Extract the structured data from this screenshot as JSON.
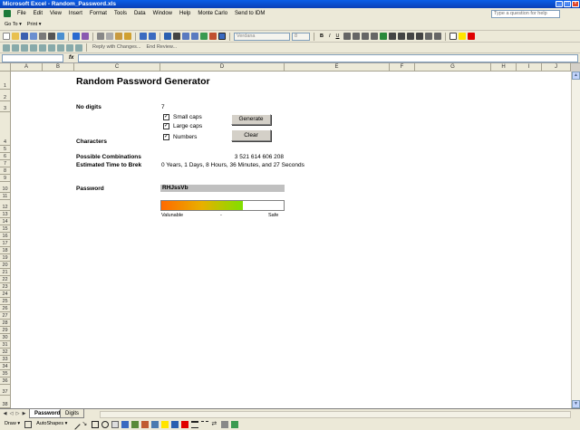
{
  "window": {
    "title": "Microsoft Excel - Random_Password.xls"
  },
  "menu": [
    "File",
    "Edit",
    "View",
    "Insert",
    "Format",
    "Tools",
    "Data",
    "Window",
    "Help",
    "Monte Carlo",
    "Send to IDM"
  ],
  "help_search": {
    "placeholder": "Type a question for help"
  },
  "toolbar": {
    "goto_label": "Go To",
    "print_label": "Print",
    "font_name": "Verdana",
    "font_size": "8",
    "reply_changes": "Reply with Changes...",
    "end_review": "End Review..."
  },
  "formula_bar": {
    "fx": "fx"
  },
  "columns": [
    "A",
    "B",
    "C",
    "D",
    "E",
    "F",
    "G",
    "H",
    "I",
    "J"
  ],
  "rows": [
    "1",
    "2",
    "3",
    "4",
    "5",
    "6",
    "7",
    "8",
    "9",
    "10",
    "11",
    "12",
    "13",
    "14",
    "15",
    "16",
    "17",
    "18",
    "19",
    "20",
    "21",
    "22",
    "23",
    "24",
    "25",
    "26",
    "27",
    "28",
    "29",
    "30",
    "31",
    "32",
    "33",
    "34",
    "35",
    "36",
    "37",
    "38"
  ],
  "sheet": {
    "title": "Random Password Generator",
    "no_digits_label": "No digits",
    "no_digits_value": "7",
    "options": [
      {
        "label": "Small caps",
        "checked": true
      },
      {
        "label": "Large caps",
        "checked": true
      },
      {
        "label": "Numbers",
        "checked": true
      }
    ],
    "generate_label": "Generate",
    "clear_label": "Clear",
    "characters_label": "Characters",
    "combinations_label": "Possible Combinations",
    "combinations_value": "3 521 614 606 208",
    "time_label": "Estimated Time to Brek",
    "time_value": "0 Years, 1 Days, 8 Hours, 36 Minutes, and 27 Seconds",
    "password_label": "Password",
    "password_value": "RHJssVb",
    "strength_fraction": 0.67,
    "strength_left": "Valunable",
    "strength_mid": "-",
    "strength_right": "Safe"
  },
  "tabs": [
    {
      "label": "Password",
      "active": true
    },
    {
      "label": "Digits",
      "active": false
    }
  ],
  "drawbar": {
    "draw_label": "Draw",
    "autoshapes_label": "AutoShapes"
  },
  "colors": {
    "titlebar": "#0a5ee8",
    "strength_start": "#ff6a00",
    "strength_end": "#7fe000"
  }
}
